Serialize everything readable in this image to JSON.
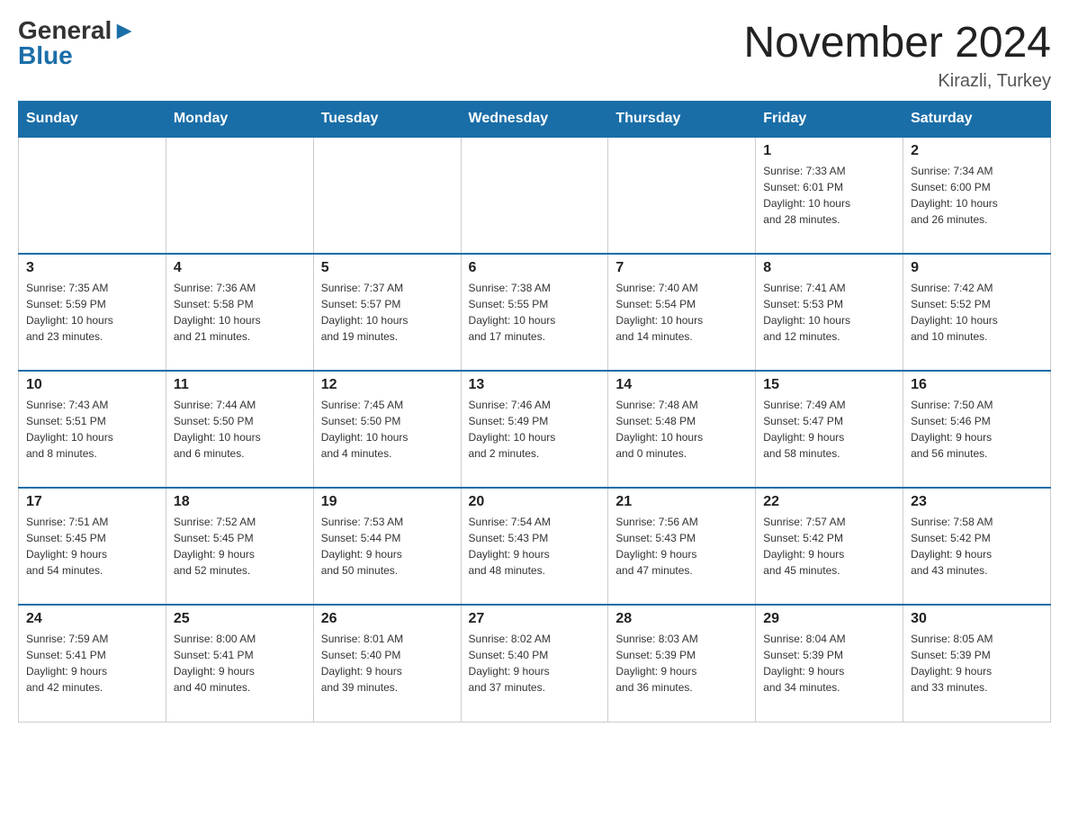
{
  "logo": {
    "general": "General",
    "blue": "Blue"
  },
  "title": "November 2024",
  "location": "Kirazli, Turkey",
  "weekdays": [
    "Sunday",
    "Monday",
    "Tuesday",
    "Wednesday",
    "Thursday",
    "Friday",
    "Saturday"
  ],
  "weeks": [
    [
      {
        "day": "",
        "info": ""
      },
      {
        "day": "",
        "info": ""
      },
      {
        "day": "",
        "info": ""
      },
      {
        "day": "",
        "info": ""
      },
      {
        "day": "",
        "info": ""
      },
      {
        "day": "1",
        "info": "Sunrise: 7:33 AM\nSunset: 6:01 PM\nDaylight: 10 hours\nand 28 minutes."
      },
      {
        "day": "2",
        "info": "Sunrise: 7:34 AM\nSunset: 6:00 PM\nDaylight: 10 hours\nand 26 minutes."
      }
    ],
    [
      {
        "day": "3",
        "info": "Sunrise: 7:35 AM\nSunset: 5:59 PM\nDaylight: 10 hours\nand 23 minutes."
      },
      {
        "day": "4",
        "info": "Sunrise: 7:36 AM\nSunset: 5:58 PM\nDaylight: 10 hours\nand 21 minutes."
      },
      {
        "day": "5",
        "info": "Sunrise: 7:37 AM\nSunset: 5:57 PM\nDaylight: 10 hours\nand 19 minutes."
      },
      {
        "day": "6",
        "info": "Sunrise: 7:38 AM\nSunset: 5:55 PM\nDaylight: 10 hours\nand 17 minutes."
      },
      {
        "day": "7",
        "info": "Sunrise: 7:40 AM\nSunset: 5:54 PM\nDaylight: 10 hours\nand 14 minutes."
      },
      {
        "day": "8",
        "info": "Sunrise: 7:41 AM\nSunset: 5:53 PM\nDaylight: 10 hours\nand 12 minutes."
      },
      {
        "day": "9",
        "info": "Sunrise: 7:42 AM\nSunset: 5:52 PM\nDaylight: 10 hours\nand 10 minutes."
      }
    ],
    [
      {
        "day": "10",
        "info": "Sunrise: 7:43 AM\nSunset: 5:51 PM\nDaylight: 10 hours\nand 8 minutes."
      },
      {
        "day": "11",
        "info": "Sunrise: 7:44 AM\nSunset: 5:50 PM\nDaylight: 10 hours\nand 6 minutes."
      },
      {
        "day": "12",
        "info": "Sunrise: 7:45 AM\nSunset: 5:50 PM\nDaylight: 10 hours\nand 4 minutes."
      },
      {
        "day": "13",
        "info": "Sunrise: 7:46 AM\nSunset: 5:49 PM\nDaylight: 10 hours\nand 2 minutes."
      },
      {
        "day": "14",
        "info": "Sunrise: 7:48 AM\nSunset: 5:48 PM\nDaylight: 10 hours\nand 0 minutes."
      },
      {
        "day": "15",
        "info": "Sunrise: 7:49 AM\nSunset: 5:47 PM\nDaylight: 9 hours\nand 58 minutes."
      },
      {
        "day": "16",
        "info": "Sunrise: 7:50 AM\nSunset: 5:46 PM\nDaylight: 9 hours\nand 56 minutes."
      }
    ],
    [
      {
        "day": "17",
        "info": "Sunrise: 7:51 AM\nSunset: 5:45 PM\nDaylight: 9 hours\nand 54 minutes."
      },
      {
        "day": "18",
        "info": "Sunrise: 7:52 AM\nSunset: 5:45 PM\nDaylight: 9 hours\nand 52 minutes."
      },
      {
        "day": "19",
        "info": "Sunrise: 7:53 AM\nSunset: 5:44 PM\nDaylight: 9 hours\nand 50 minutes."
      },
      {
        "day": "20",
        "info": "Sunrise: 7:54 AM\nSunset: 5:43 PM\nDaylight: 9 hours\nand 48 minutes."
      },
      {
        "day": "21",
        "info": "Sunrise: 7:56 AM\nSunset: 5:43 PM\nDaylight: 9 hours\nand 47 minutes."
      },
      {
        "day": "22",
        "info": "Sunrise: 7:57 AM\nSunset: 5:42 PM\nDaylight: 9 hours\nand 45 minutes."
      },
      {
        "day": "23",
        "info": "Sunrise: 7:58 AM\nSunset: 5:42 PM\nDaylight: 9 hours\nand 43 minutes."
      }
    ],
    [
      {
        "day": "24",
        "info": "Sunrise: 7:59 AM\nSunset: 5:41 PM\nDaylight: 9 hours\nand 42 minutes."
      },
      {
        "day": "25",
        "info": "Sunrise: 8:00 AM\nSunset: 5:41 PM\nDaylight: 9 hours\nand 40 minutes."
      },
      {
        "day": "26",
        "info": "Sunrise: 8:01 AM\nSunset: 5:40 PM\nDaylight: 9 hours\nand 39 minutes."
      },
      {
        "day": "27",
        "info": "Sunrise: 8:02 AM\nSunset: 5:40 PM\nDaylight: 9 hours\nand 37 minutes."
      },
      {
        "day": "28",
        "info": "Sunrise: 8:03 AM\nSunset: 5:39 PM\nDaylight: 9 hours\nand 36 minutes."
      },
      {
        "day": "29",
        "info": "Sunrise: 8:04 AM\nSunset: 5:39 PM\nDaylight: 9 hours\nand 34 minutes."
      },
      {
        "day": "30",
        "info": "Sunrise: 8:05 AM\nSunset: 5:39 PM\nDaylight: 9 hours\nand 33 minutes."
      }
    ]
  ]
}
